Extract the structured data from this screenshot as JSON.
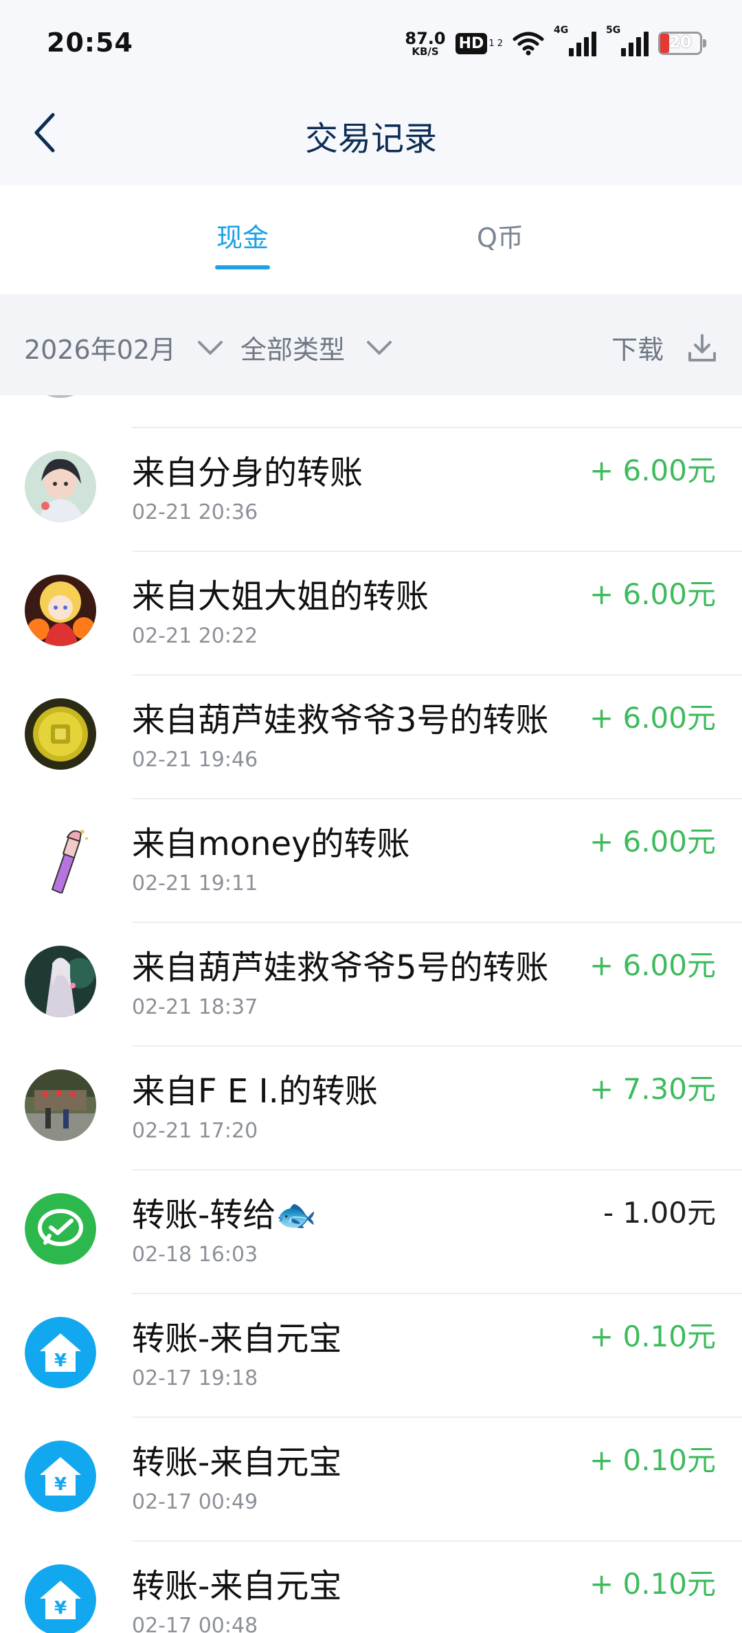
{
  "status_bar": {
    "time": "20:54",
    "net_speed_value": "87.0",
    "net_speed_unit": "KB/S",
    "hd_label": "HD",
    "hd_sub": "1 2",
    "signal_4g": "4G",
    "signal_5g": "5G",
    "battery_level": "20",
    "battery_color": "#e53935"
  },
  "header": {
    "back_icon": "chevron-left-icon",
    "title": "交易记录"
  },
  "tabs": [
    {
      "label": "现金",
      "active": true
    },
    {
      "label": "Q币",
      "active": false
    }
  ],
  "filters": {
    "month": "2026年02月",
    "type": "全部类型",
    "download": "下载"
  },
  "colors": {
    "accent": "#1aa1e6",
    "income": "#3dbb5c",
    "expense": "#1e1e1e",
    "title": "#0d2d55"
  },
  "transactions": [
    {
      "title": "来自分身的转账",
      "time": "02-21 20:36",
      "amount": "+ 6.00元",
      "avatar": "anime-girl-avatar"
    },
    {
      "title": "来自大姐大姐的转账",
      "time": "02-21 20:22",
      "amount": "+ 6.00元",
      "avatar": "blonde-doll-avatar"
    },
    {
      "title": "来自葫芦娃救爷爷3号的转账",
      "time": "02-21 19:46",
      "amount": "+ 6.00元",
      "avatar": "gold-coin-avatar"
    },
    {
      "title": "来自money的转账",
      "time": "02-21 19:11",
      "amount": "+ 6.00元",
      "avatar": "cartoon-arm-avatar"
    },
    {
      "title": "来自葫芦娃救爷爷5号的转账",
      "time": "02-21 18:37",
      "amount": "+ 6.00元",
      "avatar": "fantasy-character-avatar"
    },
    {
      "title": "来自F E I.的转账",
      "time": "02-21 17:20",
      "amount": "+ 7.30元",
      "avatar": "street-photo-avatar"
    },
    {
      "title": "转账-转给🐟",
      "time": "02-18 16:03",
      "amount": "- 1.00元",
      "avatar": "wechat-pay-icon"
    },
    {
      "title": "转账-来自元宝",
      "time": "02-17 19:18",
      "amount": "+ 0.10元",
      "avatar": "yuanbao-house-icon"
    },
    {
      "title": "转账-来自元宝",
      "time": "02-17 00:49",
      "amount": "+ 0.10元",
      "avatar": "yuanbao-house-icon"
    },
    {
      "title": "转账-来自元宝",
      "time": "02-17 00:48",
      "amount": "+ 0.10元",
      "avatar": "yuanbao-house-icon"
    }
  ]
}
